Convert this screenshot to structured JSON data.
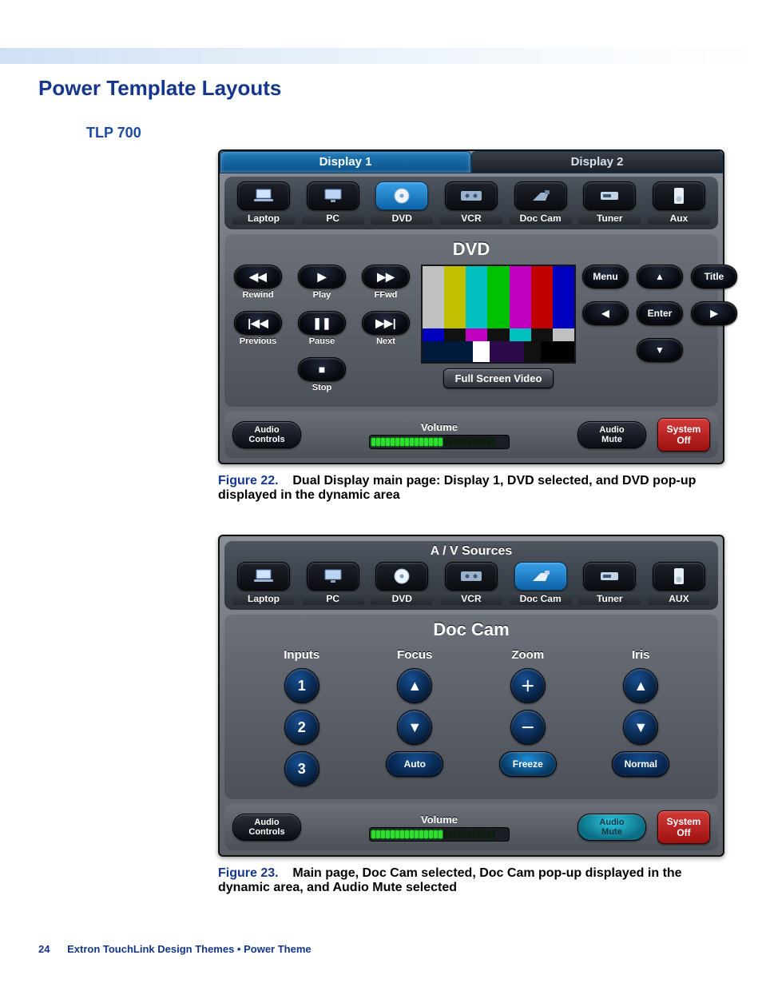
{
  "heading": "Power Template Layouts",
  "model": "TLP 700",
  "fig22": {
    "num": "Figure 22.",
    "text": "Dual Display main page: Display 1, DVD selected, and DVD pop-up displayed in the dynamic area",
    "tabs": {
      "display1": "Display 1",
      "display2": "Display 2"
    },
    "sources": {
      "laptop": "Laptop",
      "pc": "PC",
      "dvd": "DVD",
      "vcr": "VCR",
      "doccam": "Doc Cam",
      "tuner": "Tuner",
      "aux": "Aux"
    },
    "title": "DVD",
    "transport": {
      "rewind": "Rewind",
      "play": "Play",
      "ffwd": "FFwd",
      "previous": "Previous",
      "pause": "Pause",
      "next": "Next",
      "stop": "Stop"
    },
    "fullscreen": "Full Screen Video",
    "nav": {
      "menu": "Menu",
      "title": "Title",
      "enter": "Enter"
    },
    "footer": {
      "audio_controls": "Audio\nControls",
      "volume": "Volume",
      "audio_mute": "Audio\nMute",
      "system_off": "System\nOff"
    }
  },
  "fig23": {
    "num": "Figure 23.",
    "text": "Main page, Doc Cam selected, Doc Cam pop-up displayed in the dynamic area, and Audio Mute selected",
    "header": "A / V Sources",
    "sources": {
      "laptop": "Laptop",
      "pc": "PC",
      "dvd": "DVD",
      "vcr": "VCR",
      "doccam": "Doc Cam",
      "tuner": "Tuner",
      "aux": "AUX"
    },
    "title": "Doc Cam",
    "cols": {
      "inputs": "Inputs",
      "focus": "Focus",
      "zoom": "Zoom",
      "iris": "Iris"
    },
    "inputs": {
      "i1": "1",
      "i2": "2",
      "i3": "3"
    },
    "zoom": {
      "auto": "Auto",
      "freeze": "Freeze"
    },
    "iris": {
      "normal": "Normal"
    },
    "footer": {
      "audio_controls": "Audio\nControls",
      "volume": "Volume",
      "audio_mute": "Audio\nMute",
      "system_off": "System\nOff"
    }
  },
  "page_footer": {
    "number": "24",
    "text": "Extron TouchLink Design Themes • Power Theme"
  }
}
